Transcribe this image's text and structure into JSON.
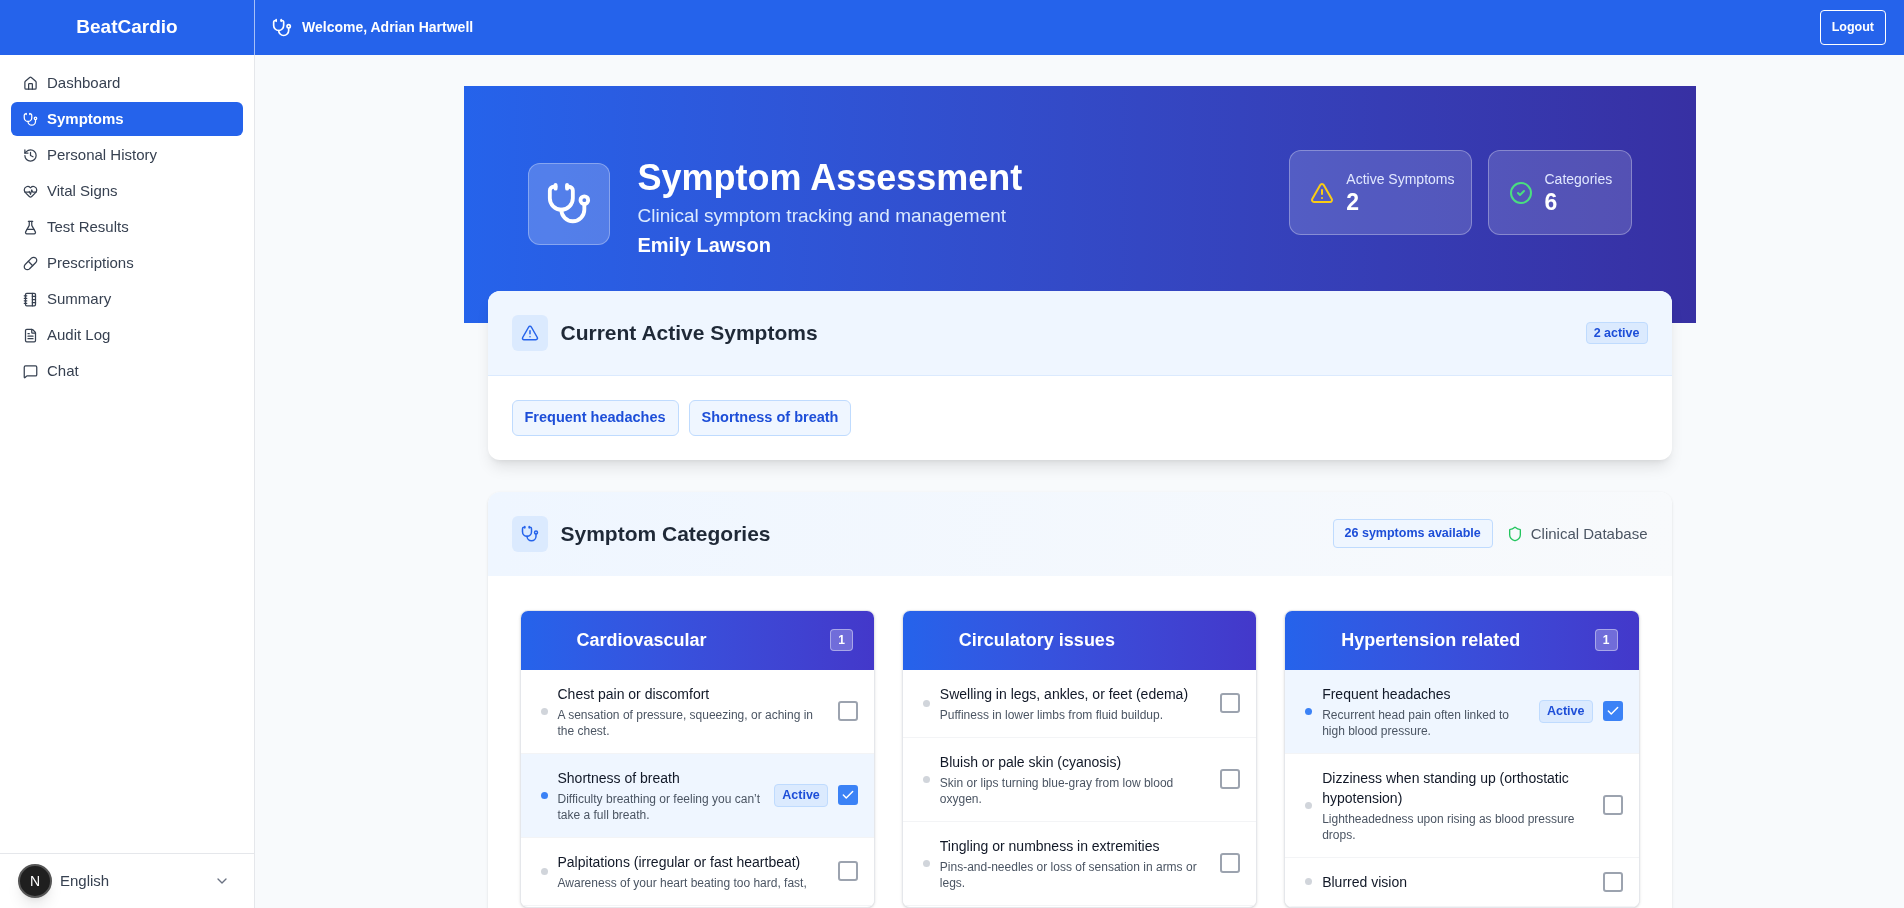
{
  "app": {
    "brand": "BeatCardio",
    "welcome": "Welcome, Adrian Hartwell",
    "logout": "Logout"
  },
  "sidebar": {
    "items": [
      {
        "label": "Dashboard",
        "selected": false
      },
      {
        "label": "Symptoms",
        "selected": true
      },
      {
        "label": "Personal History",
        "selected": false
      },
      {
        "label": "Vital Signs",
        "selected": false
      },
      {
        "label": "Test Results",
        "selected": false
      },
      {
        "label": "Prescriptions",
        "selected": false
      },
      {
        "label": "Summary",
        "selected": false
      },
      {
        "label": "Audit Log",
        "selected": false
      },
      {
        "label": "Chat",
        "selected": false
      }
    ],
    "language": "English",
    "dev_badge": "N"
  },
  "hero": {
    "title": "Symptom Assessment",
    "subtitle": "Clinical symptom tracking and management",
    "patient": "Emily Lawson",
    "stats": [
      {
        "label": "Active Symptoms",
        "value": "2",
        "kind": "warning"
      },
      {
        "label": "Categories",
        "value": "6",
        "kind": "check"
      }
    ]
  },
  "active_symptoms": {
    "title": "Current Active Symptoms",
    "badge": "2 active",
    "chips": [
      "Frequent headaches",
      "Shortness of breath"
    ]
  },
  "categories": {
    "title": "Symptom Categories",
    "badge": "26 symptoms available",
    "source": "Clinical Database",
    "columns": [
      {
        "title": "Cardiovascular",
        "count": "1",
        "symptoms": [
          {
            "name": "Chest pain or discomfort",
            "description": "A sensation of pressure, squeezing, or aching in the chest.",
            "checked": false
          },
          {
            "name": "Shortness of breath",
            "description": "Difficulty breathing or feeling you can’t take a full breath.",
            "checked": true,
            "badge": "Active"
          },
          {
            "name": "Palpitations (irregular or fast heartbeat)",
            "description": "Awareness of your heart beating too hard, fast,",
            "checked": false
          }
        ]
      },
      {
        "title": "Circulatory issues",
        "symptoms": [
          {
            "name": "Swelling in legs, ankles, or feet (edema)",
            "description": "Puffiness in lower limbs from fluid buildup.",
            "checked": false
          },
          {
            "name": "Bluish or pale skin (cyanosis)",
            "description": "Skin or lips turning blue-gray from low blood oxygen.",
            "checked": false
          },
          {
            "name": "Tingling or numbness in extremities",
            "description": "Pins-and-needles or loss of sensation in arms or legs.",
            "checked": false
          }
        ]
      },
      {
        "title": "Hypertension related",
        "count": "1",
        "symptoms": [
          {
            "name": "Frequent headaches",
            "description": "Recurrent head pain often linked to high blood pressure.",
            "checked": true,
            "badge": "Active"
          },
          {
            "name": "Dizziness when standing up (orthostatic hypotension)",
            "description": "Lightheadedness upon rising as blood pressure drops.",
            "checked": false
          },
          {
            "name": "Blurred vision",
            "checked": false
          }
        ]
      }
    ]
  }
}
